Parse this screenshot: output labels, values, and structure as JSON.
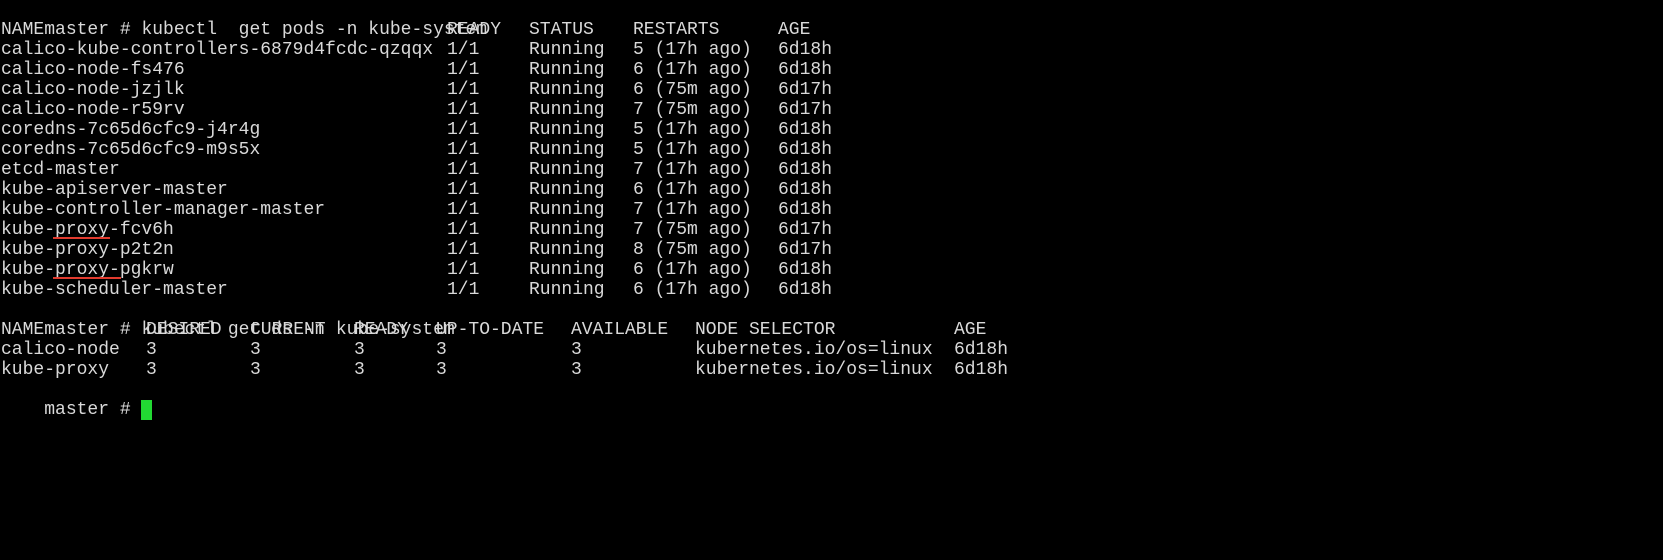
{
  "colors": {
    "background": "#000000",
    "text": "#d9d9d9",
    "cursor": "#22d933",
    "spellcheck_underline": "#e23b2e"
  },
  "prompt": "master # ",
  "cmd_pods": "kubectl  get pods -n kube-system",
  "pods": {
    "headers": [
      "NAME",
      "READY",
      "STATUS",
      "RESTARTS",
      "AGE"
    ],
    "rows": [
      [
        "calico-kube-controllers-6879d4fcdc-qzqqx",
        "1/1",
        "Running",
        "5 (17h ago)",
        "6d18h"
      ],
      [
        "calico-node-fs476",
        "1/1",
        "Running",
        "6 (17h ago)",
        "6d18h"
      ],
      [
        "calico-node-jzjlk",
        "1/1",
        "Running",
        "6 (75m ago)",
        "6d17h"
      ],
      [
        "calico-node-r59rv",
        "1/1",
        "Running",
        "7 (75m ago)",
        "6d17h"
      ],
      [
        "coredns-7c65d6cfc9-j4r4g",
        "1/1",
        "Running",
        "5 (17h ago)",
        "6d18h"
      ],
      [
        "coredns-7c65d6cfc9-m9s5x",
        "1/1",
        "Running",
        "5 (17h ago)",
        "6d18h"
      ],
      [
        "etcd-master",
        "1/1",
        "Running",
        "7 (17h ago)",
        "6d18h"
      ],
      [
        "kube-apiserver-master",
        "1/1",
        "Running",
        "6 (17h ago)",
        "6d18h"
      ],
      [
        "kube-controller-manager-master",
        "1/1",
        "Running",
        "7 (17h ago)",
        "6d18h"
      ],
      [
        "kube-proxy-fcv6h",
        "1/1",
        "Running",
        "7 (75m ago)",
        "6d17h"
      ],
      [
        "kube-proxy-p2t2n",
        "1/1",
        "Running",
        "8 (75m ago)",
        "6d17h"
      ],
      [
        "kube-proxy-pgkrw",
        "1/1",
        "Running",
        "6 (17h ago)",
        "6d18h"
      ],
      [
        "kube-scheduler-master",
        "1/1",
        "Running",
        "6 (17h ago)",
        "6d18h"
      ]
    ]
  },
  "cmd_ds": "kubectl get ds -n kube-system",
  "ds": {
    "headers": [
      "NAME",
      "DESIRED",
      "CURRENT",
      "READY",
      "UP-TO-DATE",
      "AVAILABLE",
      "NODE SELECTOR",
      "AGE"
    ],
    "rows": [
      [
        "calico-node",
        "3",
        "3",
        "3",
        "3",
        "3",
        "kubernetes.io/os=linux",
        "6d18h"
      ],
      [
        "kube-proxy",
        "3",
        "3",
        "3",
        "3",
        "3",
        "kubernetes.io/os=linux",
        "6d18h"
      ]
    ]
  },
  "final_prompt": "master # "
}
